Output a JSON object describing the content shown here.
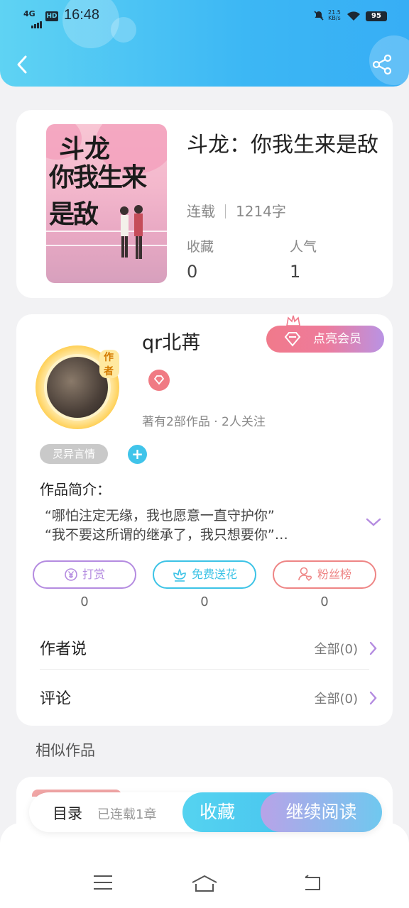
{
  "status_bar": {
    "network": "4G",
    "hd": "HD",
    "time": "16:48",
    "speed_top": "21.5",
    "speed_unit": "KB/s",
    "battery": "95"
  },
  "header": {
    "back_icon": "chevron-left-icon",
    "share_icon": "share-icon"
  },
  "book": {
    "cover_text_1": "斗龙",
    "cover_text_2": "你我生来是敌",
    "title": "斗龙：你我生来是敌",
    "status": "连载",
    "word_count": "1214字",
    "favorites_label": "收藏",
    "favorites_value": "0",
    "popularity_label": "人气",
    "popularity_value": "1"
  },
  "author": {
    "name": "qr北苒",
    "avatar_badge": "作者",
    "vip_button": "点亮会员",
    "stats": "著有2部作品 · 2人关注",
    "tag": "灵异言情",
    "add_tag": "+",
    "intro_title": "作品简介：",
    "intro_line_1": "“哪怕注定无缘，我也愿意一直守护你”",
    "intro_line_2": "“我不要这所谓的继承了，我只想要你”…"
  },
  "actions": [
    {
      "label": "打赏",
      "count": "0",
      "icon": "yen-coin-icon",
      "color": "#b48be0"
    },
    {
      "label": "免费送花",
      "count": "0",
      "icon": "flower-icon",
      "color": "#3cc3e6"
    },
    {
      "label": "粉丝榜",
      "count": "0",
      "icon": "fan-rank-icon",
      "color": "#ee8585"
    }
  ],
  "rows": [
    {
      "label": "作者说",
      "value": "全部(0)"
    },
    {
      "label": "评论",
      "value": "全部(0)"
    }
  ],
  "similar": {
    "title": "相似作品"
  },
  "bottom_bar": {
    "toc": "目录",
    "toc_sub": "已连载1章",
    "favorite": "收藏",
    "continue": "继续阅读"
  },
  "nav": {
    "menu": "menu-icon",
    "home": "home-icon",
    "back": "back-icon"
  }
}
